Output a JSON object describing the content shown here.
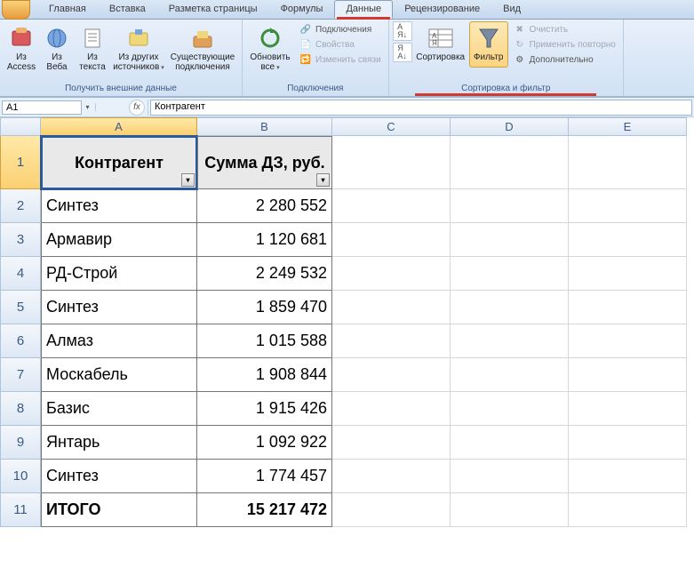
{
  "tabs": [
    "Главная",
    "Вставка",
    "Разметка страницы",
    "Формулы",
    "Данные",
    "Рецензирование",
    "Вид"
  ],
  "active_tab": 4,
  "ribbon": {
    "external": {
      "title": "Получить внешние данные",
      "access": "Из Access",
      "web": "Из Веба",
      "text": "Из текста",
      "other": "Из других источников",
      "existing": "Существующие подключения"
    },
    "connections": {
      "title": "Подключения",
      "refresh": "Обновить все",
      "conn": "Подключения",
      "props": "Свойства",
      "links": "Изменить связи"
    },
    "sort_filter": {
      "title": "Сортировка и фильтр",
      "sort_az": "А↓Я",
      "sort_za": "Я↓А",
      "sort": "Сортировка",
      "filter": "Фильтр",
      "clear": "Очистить",
      "reapply": "Применить повторно",
      "advanced": "Дополнительно"
    }
  },
  "formula_bar": {
    "name_box": "A1",
    "fx": "fx",
    "value": "Контрагент"
  },
  "columns": [
    "A",
    "B",
    "C",
    "D",
    "E"
  ],
  "header": {
    "col_a": "Контрагент",
    "col_b": "Сумма ДЗ, руб."
  },
  "data": [
    {
      "a": "Синтез",
      "b": "2 280 552"
    },
    {
      "a": "Армавир",
      "b": "1 120 681"
    },
    {
      "a": "РД-Строй",
      "b": "2 249 532"
    },
    {
      "a": "Синтез",
      "b": "1 859 470"
    },
    {
      "a": "Алмаз",
      "b": "1 015 588"
    },
    {
      "a": "Москабель",
      "b": "1 908 844"
    },
    {
      "a": "Базис",
      "b": "1 915 426"
    },
    {
      "a": "Янтарь",
      "b": "1 092 922"
    },
    {
      "a": "Синтез",
      "b": "1 774 457"
    }
  ],
  "total": {
    "label": "ИТОГО",
    "value": "15 217 472"
  }
}
